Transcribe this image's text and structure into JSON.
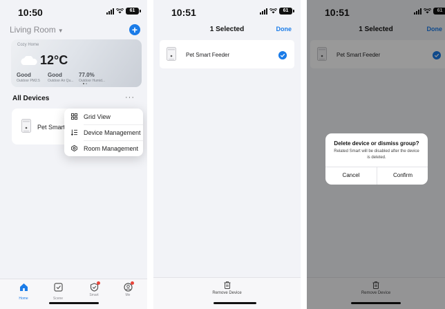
{
  "colors": {
    "accent": "#1b7ce8",
    "badge": "#e8443a",
    "overlay": "rgba(0,0,0,0.40)"
  },
  "status": {
    "time1": "10:50",
    "time2": "10:51",
    "time3": "10:51",
    "battery": "61"
  },
  "home": {
    "room_title": "Living Room",
    "add_icon": "plus-icon",
    "weather": {
      "home_name": "Cozy Home",
      "temperature": "12°C",
      "icon": "cloud-icon",
      "stats": [
        {
          "value": "Good",
          "label": "Outdoor PM2.5"
        },
        {
          "value": "Good",
          "label": "Outdoor Air Qu..."
        },
        {
          "value": "77.0%",
          "label": "Outdoor Humid..."
        }
      ]
    },
    "all_devices": "All Devices",
    "more": "···",
    "device_name": "Pet Smart",
    "menu": [
      {
        "label": "Grid View",
        "icon": "grid-icon"
      },
      {
        "label": "Device Management",
        "icon": "list-sort-icon"
      },
      {
        "label": "Room Management",
        "icon": "room-icon"
      }
    ],
    "tabs": [
      {
        "label": "Home",
        "icon": "home-icon"
      },
      {
        "label": "Scene",
        "icon": "scene-icon"
      },
      {
        "label": "Smart",
        "icon": "smart-icon"
      },
      {
        "label": "Me",
        "icon": "me-icon"
      }
    ]
  },
  "manage": {
    "title": "1 Selected",
    "done": "Done",
    "device_name": "Pet Smart Feeder",
    "remove_label": "Remove Device"
  },
  "dialog": {
    "title": "Delete device or dismiss group?",
    "message": "Related Smart will be disabled after the device is deleted.",
    "cancel": "Cancel",
    "confirm": "Confirm"
  }
}
